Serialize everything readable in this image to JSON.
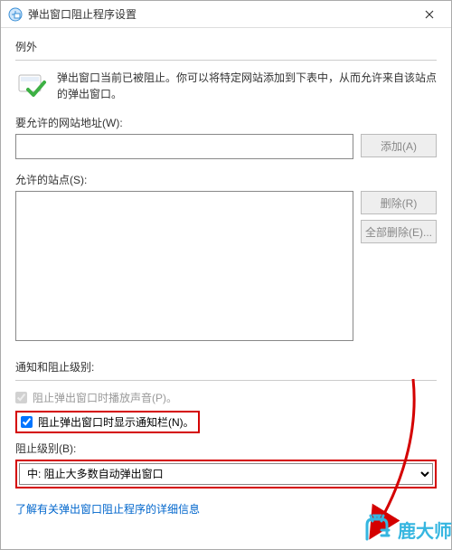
{
  "window": {
    "title": "弹出窗口阻止程序设置"
  },
  "exception": {
    "heading": "例外",
    "description": "弹出窗口当前已被阻止。你可以将特定网站添加到下表中，从而允许来自该站点的弹出窗口。"
  },
  "address": {
    "label": "要允许的网站地址(W):",
    "value": "",
    "add_btn": "添加(A)"
  },
  "allowed": {
    "label": "允许的站点(S):",
    "remove_btn": "删除(R)",
    "remove_all_btn": "全部删除(E)..."
  },
  "notify": {
    "heading": "通知和阻止级别:",
    "cb_sound": "阻止弹出窗口时播放声音(P)。",
    "cb_notify_bar": "阻止弹出窗口时显示通知栏(N)。",
    "level_label": "阻止级别(B):",
    "level_value": "中: 阻止大多数自动弹出窗口"
  },
  "link_text": "了解有关弹出窗口阻止程序的详细信息",
  "watermark": "鹿大师"
}
